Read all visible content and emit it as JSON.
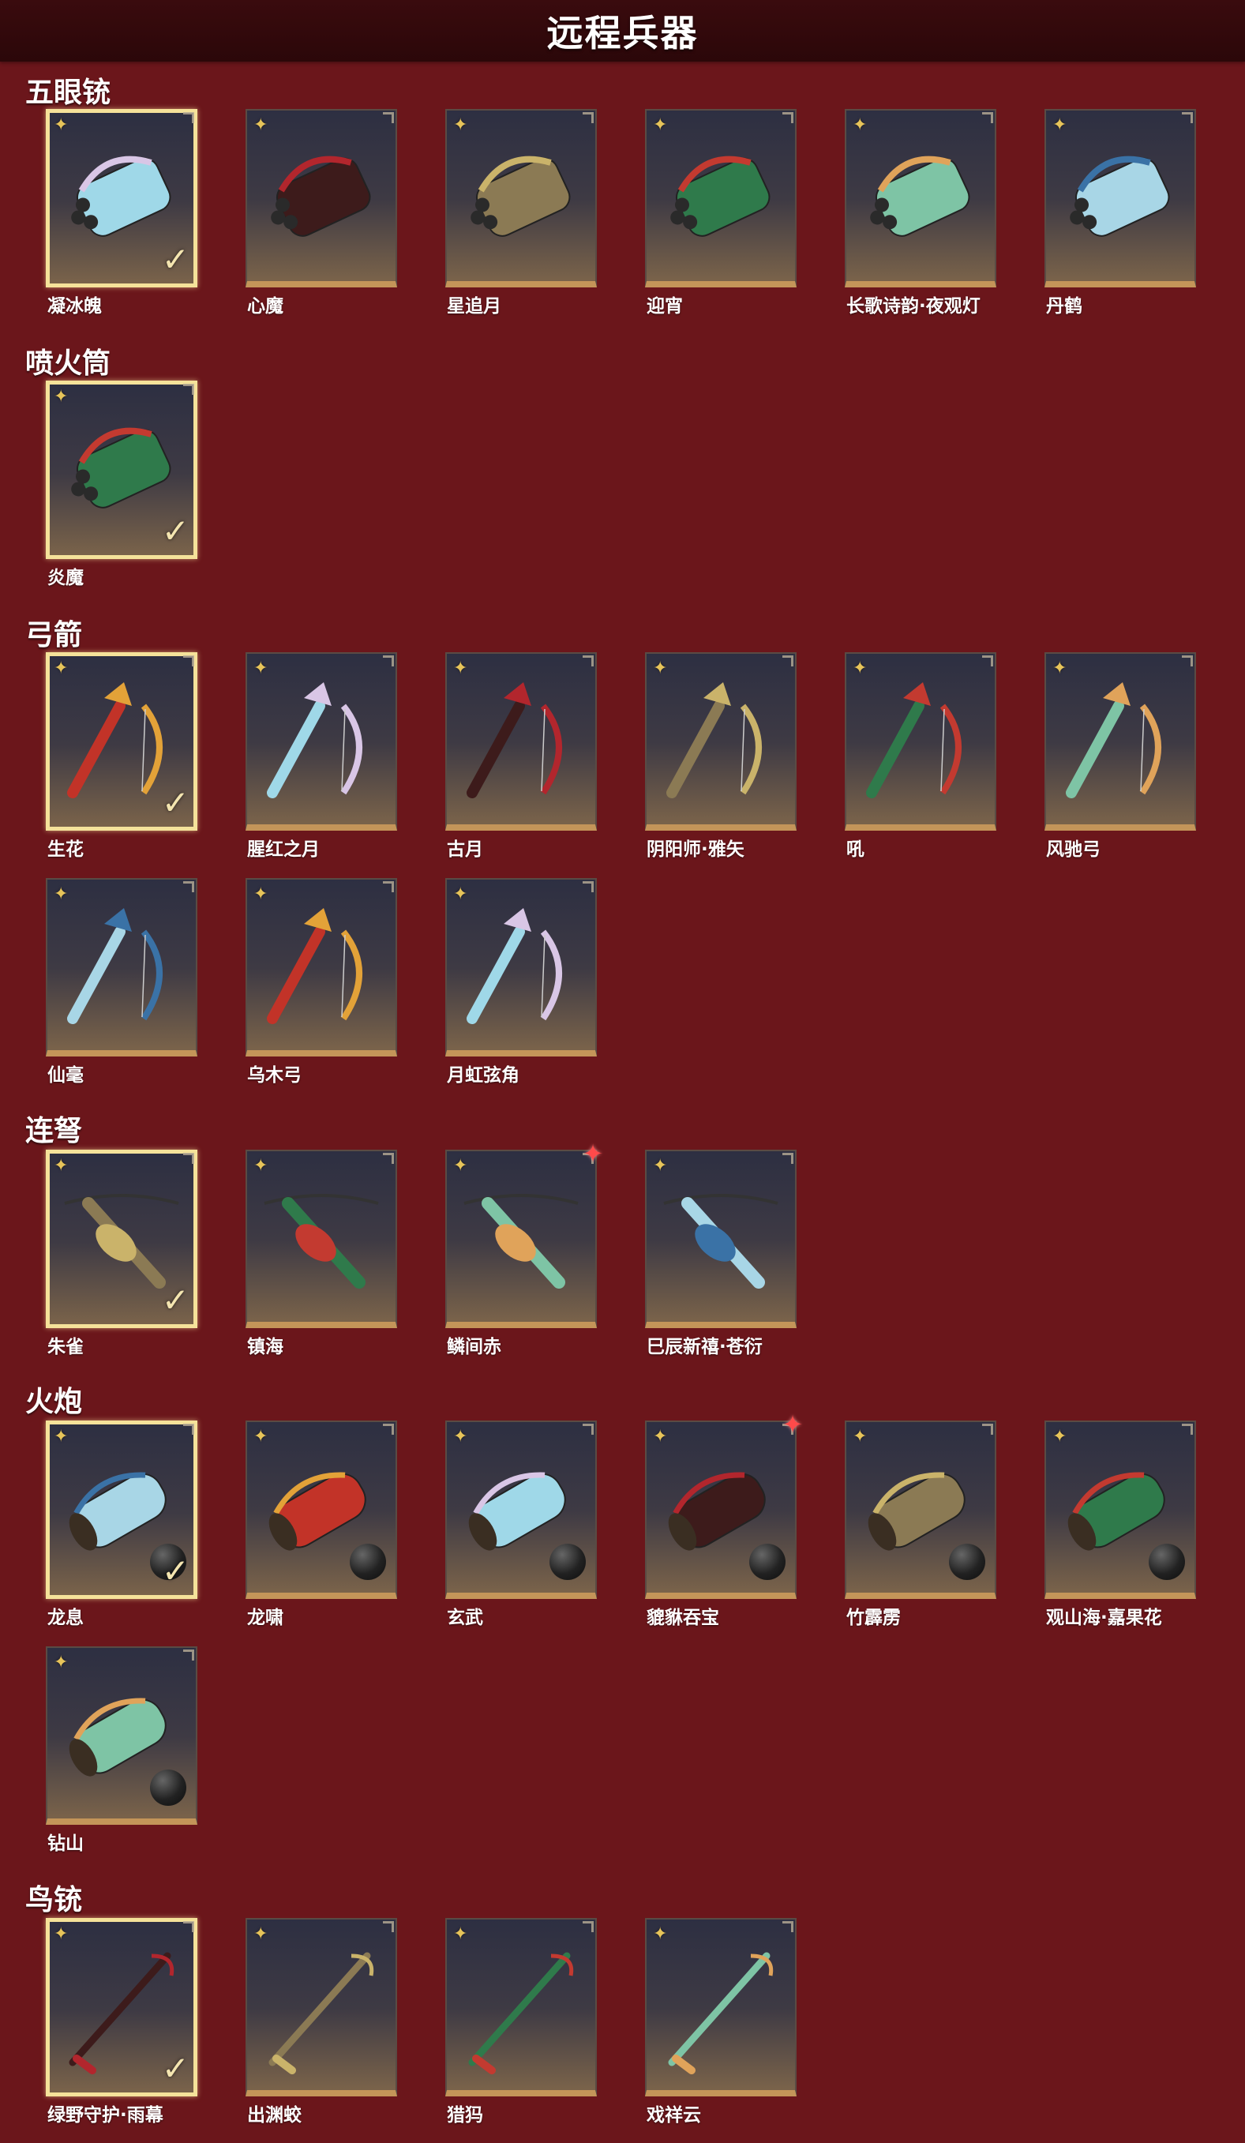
{
  "page": {
    "title": "远程兵器"
  },
  "colors": {
    "background": "#6b161b",
    "header": "#2b0709",
    "selected_border": "#f5e29a",
    "card_bottom": "#c49559",
    "rank_icon": "#e7c45a",
    "new_badge": "#ff4a4a"
  },
  "icons": {
    "rank": "✦",
    "check": "✓",
    "new_badge": "✦",
    "cannonball": "cannonball-icon"
  },
  "sections": [
    {
      "title": "五眼铳",
      "items": [
        {
          "name": "凝冰魄",
          "selected": true
        },
        {
          "name": "心魔"
        },
        {
          "name": "星追月"
        },
        {
          "name": "迎宵"
        },
        {
          "name": "长歌诗韵·夜观灯"
        },
        {
          "name": "丹鹤"
        }
      ]
    },
    {
      "title": "喷火筒",
      "items": [
        {
          "name": "炎魔",
          "selected": true
        }
      ]
    },
    {
      "title": "弓箭",
      "items": [
        {
          "name": "生花",
          "selected": true
        },
        {
          "name": "腥红之月"
        },
        {
          "name": "古月"
        },
        {
          "name": "阴阳师·雅矢"
        },
        {
          "name": "吼"
        },
        {
          "name": "风驰弓"
        },
        {
          "name": "仙毫"
        },
        {
          "name": "乌木弓"
        },
        {
          "name": "月虹弦角"
        }
      ]
    },
    {
      "title": "连弩",
      "items": [
        {
          "name": "朱雀",
          "selected": true
        },
        {
          "name": "镇海"
        },
        {
          "name": "鳞间赤",
          "new_badge": true
        },
        {
          "name": "巳辰新禧·苍衍"
        }
      ]
    },
    {
      "title": "火炮",
      "items": [
        {
          "name": "龙息",
          "selected": true,
          "ball": true
        },
        {
          "name": "龙啸",
          "ball": true
        },
        {
          "name": "玄武",
          "ball": true
        },
        {
          "name": "貔貅吞宝",
          "ball": true,
          "new_badge": true
        },
        {
          "name": "竹霹雳",
          "ball": true
        },
        {
          "name": "观山海·嘉果花",
          "ball": true
        },
        {
          "name": "钻山",
          "ball": true
        }
      ]
    },
    {
      "title": "鸟铳",
      "items": [
        {
          "name": "绿野守护·雨幕",
          "selected": true
        },
        {
          "name": "出渊蛟"
        },
        {
          "name": "猎犸"
        },
        {
          "name": "戏祥云"
        }
      ]
    }
  ]
}
